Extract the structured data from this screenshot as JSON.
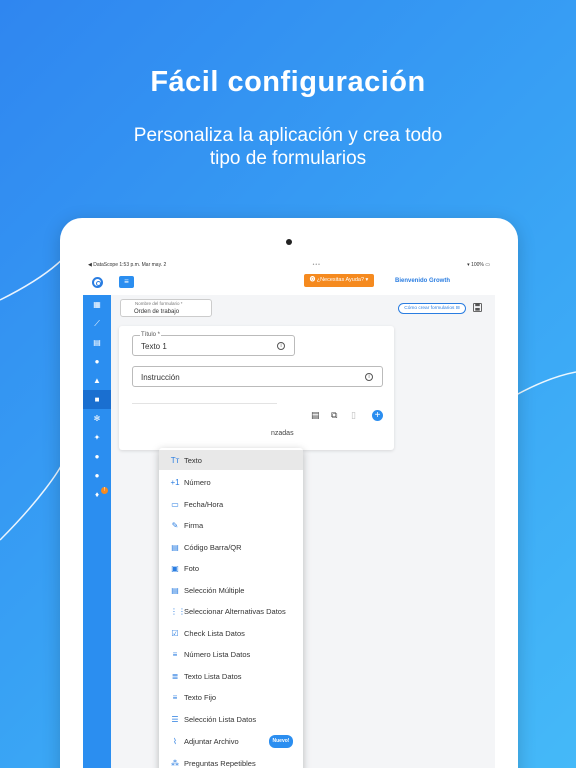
{
  "hero": {
    "title": "Fácil configuración",
    "subtitle_line1": "Personaliza la aplicación y crea todo",
    "subtitle_line2": "tipo de formularios"
  },
  "statusbar": {
    "carrier": "◀ DataScope",
    "time": "1:53 p.m.",
    "date": "Mar may. 2",
    "dots": "•••",
    "battery": "100%"
  },
  "topbar": {
    "help_label": "⓿ ¿Necesitas Ayuda? ▾",
    "welcome": "Bienvenido Growth"
  },
  "form": {
    "name_label": "Nombre del formulario *",
    "name_value": "Orden de trabajo",
    "how_to_label": "Cómo crear formularios ⊟"
  },
  "card": {
    "title_label": "Título *",
    "title_value": "Texto 1",
    "instruction_placeholder": "Instrucción",
    "partial_text": "nzadas"
  },
  "dropdown": {
    "items": [
      {
        "label": "Texto",
        "icon": "Tт"
      },
      {
        "label": "Número",
        "icon": "+1"
      },
      {
        "label": "Fecha/Hora",
        "icon": "▭"
      },
      {
        "label": "Firma",
        "icon": "✎"
      },
      {
        "label": "Código Barra/QR",
        "icon": "▤"
      },
      {
        "label": "Foto",
        "icon": "▣"
      },
      {
        "label": "Selección Múltiple",
        "icon": "▤"
      },
      {
        "label": "Seleccionar Alternativas Datos",
        "icon": "⋮⋮"
      },
      {
        "label": "Check Lista Datos",
        "icon": "☑"
      },
      {
        "label": "Número Lista Datos",
        "icon": "≡"
      },
      {
        "label": "Texto Lista Datos",
        "icon": "≣"
      },
      {
        "label": "Texto Fijo",
        "icon": "≡"
      },
      {
        "label": "Selección Lista Datos",
        "icon": "☰"
      },
      {
        "label": "Adjuntar Archivo",
        "icon": "⌇"
      },
      {
        "label": "Preguntas Repetibles",
        "icon": "⁂"
      }
    ],
    "new_badge": "Nuevo!"
  },
  "sidebar": {
    "badge": "!"
  },
  "colors": {
    "primary": "#2b8ef0",
    "orange": "#f58a1f"
  }
}
